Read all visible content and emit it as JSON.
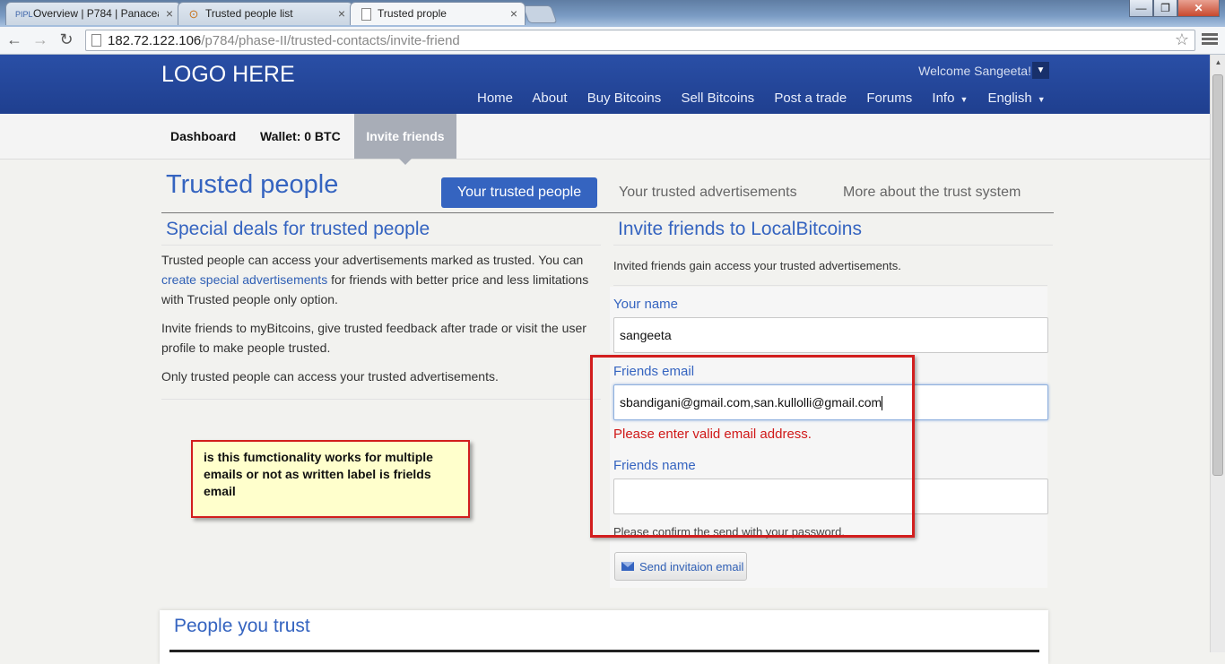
{
  "browser": {
    "tabs": [
      {
        "favicon": "PIPL",
        "title": "Overview | P784 | Panacea",
        "close": "×"
      },
      {
        "favicon": "⊙",
        "title": "Trusted people list",
        "close": "×"
      },
      {
        "favicon": "",
        "title": "Trusted prople",
        "close": "×"
      }
    ],
    "window_controls": {
      "minimize": "—",
      "restore": "❐",
      "close": "✕"
    },
    "nav": {
      "back": "←",
      "forward": "→",
      "reload": "↻"
    },
    "url_host": "182.72.122.106",
    "url_path": "/p784/phase-II/trusted-contacts/invite-friend",
    "star": "☆"
  },
  "header": {
    "logo": "LOGO HERE",
    "welcome": "Welcome Sangeeta!",
    "welcome_caret": "▼",
    "nav": {
      "home": "Home",
      "about": "About",
      "buy": "Buy Bitcoins",
      "sell": "Sell Bitcoins",
      "post": "Post a trade",
      "forums": "Forums",
      "info": "Info",
      "english": "English",
      "caret": "▼"
    }
  },
  "subnav": {
    "dashboard": "Dashboard",
    "wallet": "Wallet: 0 BTC",
    "invite": "Invite friends"
  },
  "page": {
    "title": "Trusted people",
    "tabs": {
      "your_trusted_people": "Your trusted people",
      "your_trusted_ads": "Your trusted advertisements",
      "more_about": "More about the trust system"
    }
  },
  "left": {
    "heading": "Special deals for trusted people",
    "p1_before": "Trusted people can access your advertisements marked as trusted. You can",
    "p1_link": "create special advertisements",
    "p1_after": "for friends with better price and less limitations",
    "p1_line3": "with Trusted people only option.",
    "p2_line1": "Invite friends to myBitcoins, give trusted feedback after trade or visit the user",
    "p2_line2": "profile to make people trusted.",
    "p3": "Only trusted people can access your trusted advertisements."
  },
  "right": {
    "heading": "Invite friends to LocalBitcoins",
    "intro": "Invited friends gain access your trusted advertisements.",
    "your_name_label": "Your name",
    "your_name_value": "sangeeta",
    "friends_email_label": "Friends email",
    "friends_email_value": "sbandigani@gmail.com,san.kullolli@gmail.com",
    "error": "Please enter valid email address.",
    "friends_name_label": "Friends name",
    "friends_name_value": "",
    "confirm": "Please confirm the send with your password.",
    "send_button": "Send invitaion email"
  },
  "annotation": {
    "note": "is this fumctionality works for multiple emails or not as written label is frields email"
  },
  "people": {
    "heading": "People you trust"
  }
}
